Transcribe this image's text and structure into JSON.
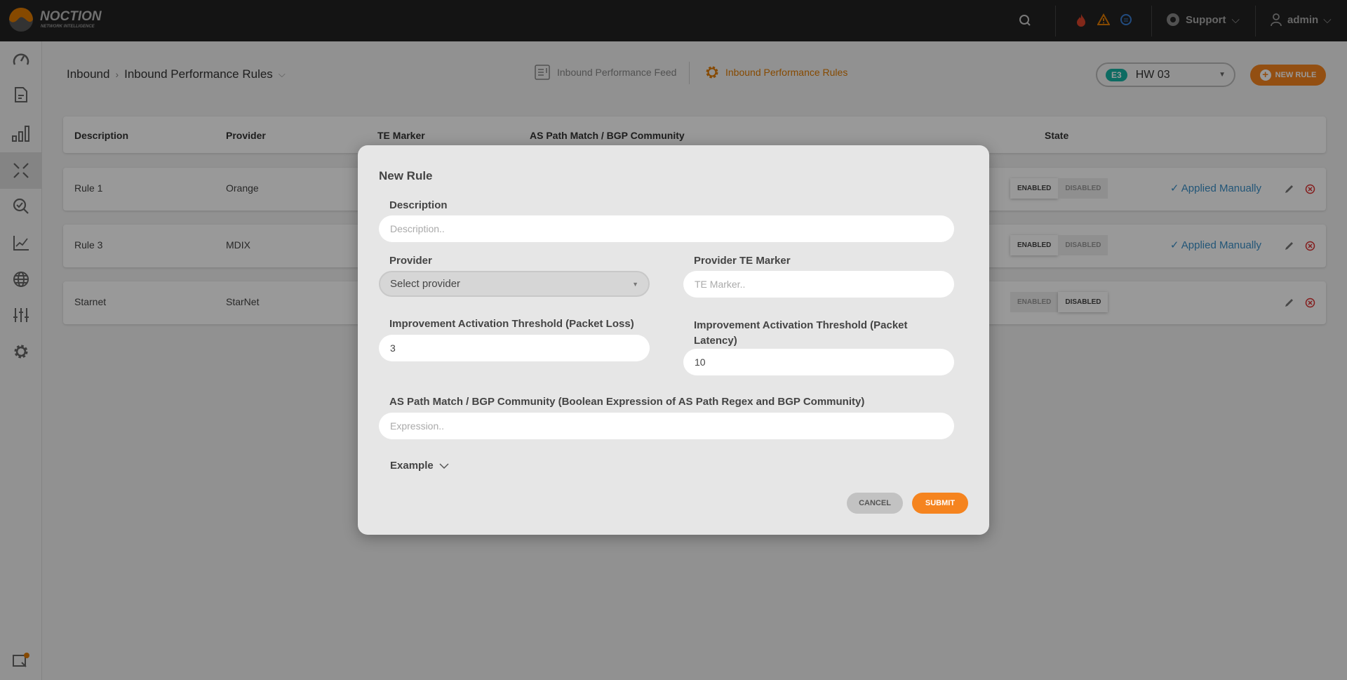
{
  "topbar": {
    "logo": "NOCTION",
    "logo_sub": "NETWORK INTELLIGENCE",
    "support": "Support",
    "user": "admin",
    "icons": [
      "search-icon",
      "fire-icon",
      "warning-icon",
      "chat-icon",
      "lifebuoy-icon",
      "user-icon"
    ],
    "colors": {
      "fire": "#d9442b",
      "warning": "#e07b00",
      "chat": "#3a7fd5"
    }
  },
  "sidebar": {
    "items": [
      "dashboard-icon",
      "reports-icon",
      "bar-chart-icon",
      "inbound-icon",
      "search-check-icon",
      "trend-chart-icon",
      "globe-icon",
      "sliders-icon",
      "gear-icon"
    ],
    "active": "inbound-icon",
    "bottom": "notification-icon"
  },
  "breadcrumb": {
    "root": "Inbound",
    "current": "Inbound Performance Rules"
  },
  "tabs": [
    {
      "label": "Inbound Performance Feed",
      "active": false
    },
    {
      "label": "Inbound Performance Rules",
      "active": true
    }
  ],
  "instance": {
    "badge": "E3",
    "name": "HW 03"
  },
  "new_rule_button": "NEW RULE",
  "accent": "#f5841f",
  "table": {
    "headers": [
      "Description",
      "Provider",
      "TE Marker",
      "AS Path Match / BGP Community",
      "State"
    ],
    "rows": [
      {
        "description": "Rule 1",
        "provider": "Orange",
        "state": "ENABLED",
        "status": "Applied Manually"
      },
      {
        "description": "Rule 3",
        "provider": "MDIX",
        "state": "ENABLED",
        "status": "Applied Manually"
      },
      {
        "description": "Starnet",
        "provider": "StarNet",
        "state": "DISABLED",
        "status": ""
      }
    ],
    "enabled_label": "ENABLED",
    "disabled_label": "DISABLED"
  },
  "modal": {
    "title": "New Rule",
    "description_label": "Description",
    "description_placeholder": "Description..",
    "provider_label": "Provider",
    "provider_value": "Select provider",
    "te_label": "Provider TE Marker",
    "te_placeholder": "TE Marker..",
    "loss_label": "Improvement Activation Threshold (Packet Loss)",
    "loss_value": "3",
    "latency_label": "Improvement Activation Threshold (Packet Latency)",
    "latency_value": "10",
    "expr_label": "AS Path Match / BGP Community (Boolean Expression of AS Path Regex and BGP Community)",
    "expr_placeholder": "Expression..",
    "example_label": "Example",
    "cancel": "CANCEL",
    "submit": "SUBMIT"
  }
}
